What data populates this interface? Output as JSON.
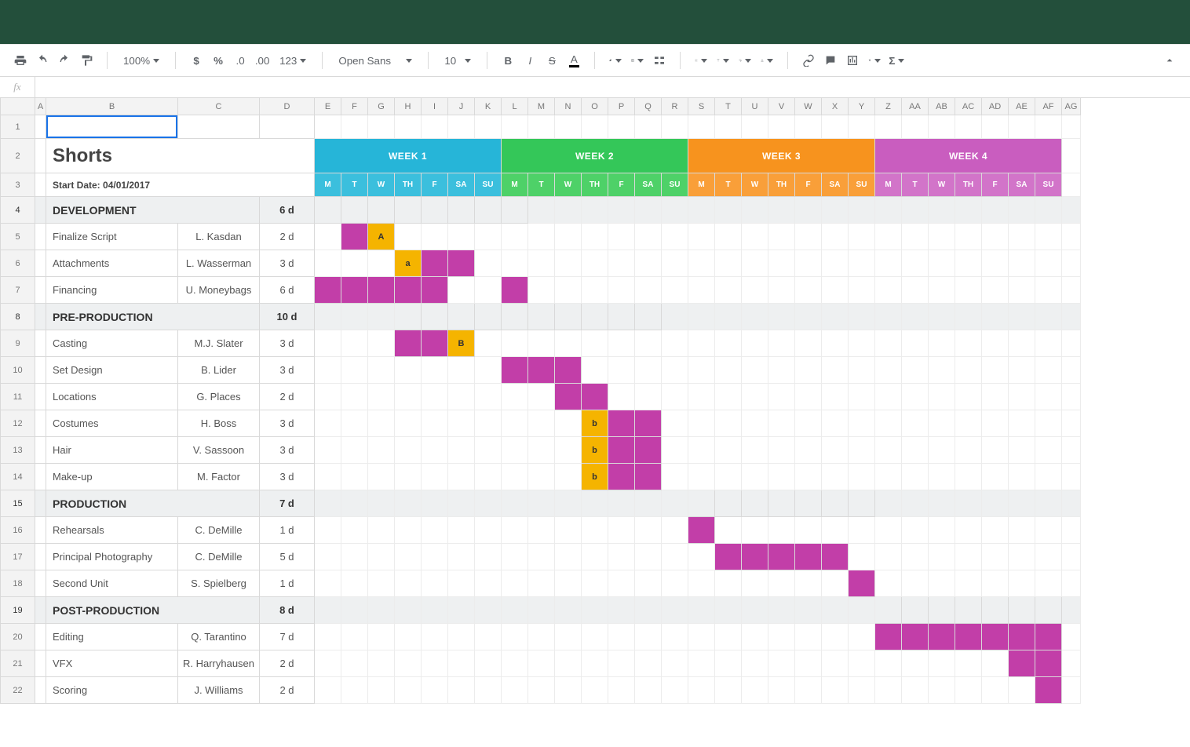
{
  "toolbar": {
    "zoom": "100%",
    "font": "Open Sans",
    "size": "10"
  },
  "sheet": {
    "title": "Shorts",
    "start_label": "Start Date: 04/01/2017",
    "columns": [
      "A",
      "B",
      "C",
      "D",
      "E",
      "F",
      "G",
      "H",
      "I",
      "J",
      "K",
      "L",
      "M",
      "N",
      "O",
      "P",
      "Q",
      "R",
      "S",
      "T",
      "U",
      "V",
      "W",
      "X",
      "Y",
      "Z",
      "AA",
      "AB",
      "AC",
      "AD",
      "AE",
      "AF",
      "AG"
    ],
    "weeks": [
      {
        "label": "WEEK 1",
        "cls": "wk1"
      },
      {
        "label": "WEEK 2",
        "cls": "wk2"
      },
      {
        "label": "WEEK 3",
        "cls": "wk3"
      },
      {
        "label": "WEEK 4",
        "cls": "wk4"
      }
    ],
    "days": [
      "M",
      "T",
      "W",
      "TH",
      "F",
      "SA",
      "SU"
    ],
    "rows": [
      {
        "n": 4,
        "type": "section",
        "name": "DEVELOPMENT",
        "dur": "6 d",
        "bar": {
          "cls": "bD",
          "from": 0,
          "to": 7
        }
      },
      {
        "n": 5,
        "type": "task",
        "name": "Finalize Script",
        "who": "L. Kasdan",
        "dur": "2 d",
        "cells": [
          {
            "i": 1,
            "cls": "bP"
          },
          {
            "i": 2,
            "cls": "bO",
            "t": "A"
          }
        ]
      },
      {
        "n": 6,
        "type": "task",
        "name": "Attachments",
        "who": "L. Wasserman",
        "dur": "3 d",
        "cells": [
          {
            "i": 3,
            "cls": "bO",
            "t": "a"
          },
          {
            "i": 4,
            "cls": "bP"
          },
          {
            "i": 5,
            "cls": "bP"
          }
        ]
      },
      {
        "n": 7,
        "type": "task",
        "name": "Financing",
        "who": "U. Moneybags",
        "dur": "6 d",
        "cells": [
          {
            "i": 0,
            "cls": "bP"
          },
          {
            "i": 1,
            "cls": "bP"
          },
          {
            "i": 2,
            "cls": "bP"
          },
          {
            "i": 3,
            "cls": "bP"
          },
          {
            "i": 4,
            "cls": "bP"
          },
          {
            "i": 7,
            "cls": "bP"
          }
        ]
      },
      {
        "n": 8,
        "type": "section",
        "name": "PRE-PRODUCTION",
        "dur": "10 d",
        "bar": {
          "cls": "bD",
          "from": 3,
          "to": 12
        }
      },
      {
        "n": 9,
        "type": "task",
        "name": "Casting",
        "who": "M.J. Slater",
        "dur": "3 d",
        "cells": [
          {
            "i": 3,
            "cls": "bP"
          },
          {
            "i": 4,
            "cls": "bP"
          },
          {
            "i": 5,
            "cls": "bO",
            "t": "B"
          }
        ]
      },
      {
        "n": 10,
        "type": "task",
        "name": "Set Design",
        "who": "B. Lider",
        "dur": "3 d",
        "cells": [
          {
            "i": 7,
            "cls": "bP"
          },
          {
            "i": 8,
            "cls": "bP"
          },
          {
            "i": 9,
            "cls": "bP"
          }
        ]
      },
      {
        "n": 11,
        "type": "task",
        "name": "Locations",
        "who": "G. Places",
        "dur": "2 d",
        "cells": [
          {
            "i": 9,
            "cls": "bP"
          },
          {
            "i": 10,
            "cls": "bP"
          }
        ]
      },
      {
        "n": 12,
        "type": "task",
        "name": "Costumes",
        "who": "H. Boss",
        "dur": "3 d",
        "cells": [
          {
            "i": 10,
            "cls": "bO",
            "t": "b"
          },
          {
            "i": 11,
            "cls": "bP"
          },
          {
            "i": 12,
            "cls": "bP"
          }
        ]
      },
      {
        "n": 13,
        "type": "task",
        "name": "Hair",
        "who": "V. Sassoon",
        "dur": "3 d",
        "cells": [
          {
            "i": 10,
            "cls": "bO",
            "t": "b"
          },
          {
            "i": 11,
            "cls": "bP"
          },
          {
            "i": 12,
            "cls": "bP"
          }
        ]
      },
      {
        "n": 14,
        "type": "task",
        "name": "Make-up",
        "who": "M. Factor",
        "dur": "3 d",
        "cells": [
          {
            "i": 10,
            "cls": "bO",
            "t": "b"
          },
          {
            "i": 11,
            "cls": "bP"
          },
          {
            "i": 12,
            "cls": "bP"
          }
        ]
      },
      {
        "n": 15,
        "type": "section",
        "name": "PRODUCTION",
        "dur": "7 d",
        "bar": {
          "cls": "bD",
          "from": 14,
          "to": 20
        }
      },
      {
        "n": 16,
        "type": "task",
        "name": "Rehearsals",
        "who": "C. DeMille",
        "dur": "1 d",
        "cells": [
          {
            "i": 14,
            "cls": "bP"
          }
        ]
      },
      {
        "n": 17,
        "type": "task",
        "name": "Principal Photography",
        "who": "C. DeMille",
        "dur": "5 d",
        "cells": [
          {
            "i": 15,
            "cls": "bP"
          },
          {
            "i": 16,
            "cls": "bP"
          },
          {
            "i": 17,
            "cls": "bP"
          },
          {
            "i": 18,
            "cls": "bP"
          },
          {
            "i": 19,
            "cls": "bP"
          }
        ]
      },
      {
        "n": 18,
        "type": "task",
        "name": "Second Unit",
        "who": "S. Spielberg",
        "dur": "1 d",
        "cells": [
          {
            "i": 20,
            "cls": "bP"
          }
        ]
      },
      {
        "n": 19,
        "type": "section",
        "name": "POST-PRODUCTION",
        "dur": "8 d",
        "bar": {
          "cls": "bD",
          "from": 21,
          "to": 27
        }
      },
      {
        "n": 20,
        "type": "task",
        "name": "Editing",
        "who": "Q. Tarantino",
        "dur": "7 d",
        "cells": [
          {
            "i": 21,
            "cls": "bP"
          },
          {
            "i": 22,
            "cls": "bP"
          },
          {
            "i": 23,
            "cls": "bP"
          },
          {
            "i": 24,
            "cls": "bP"
          },
          {
            "i": 25,
            "cls": "bP"
          },
          {
            "i": 26,
            "cls": "bP"
          },
          {
            "i": 27,
            "cls": "bP"
          }
        ]
      },
      {
        "n": 21,
        "type": "task",
        "name": "VFX",
        "who": "R. Harryhausen",
        "dur": "2 d",
        "cells": [
          {
            "i": 26,
            "cls": "bP"
          },
          {
            "i": 27,
            "cls": "bP"
          }
        ]
      },
      {
        "n": 22,
        "type": "task",
        "name": "Scoring",
        "who": "J. Williams",
        "dur": "2 d",
        "cells": [
          {
            "i": 27,
            "cls": "bP"
          }
        ]
      }
    ]
  }
}
